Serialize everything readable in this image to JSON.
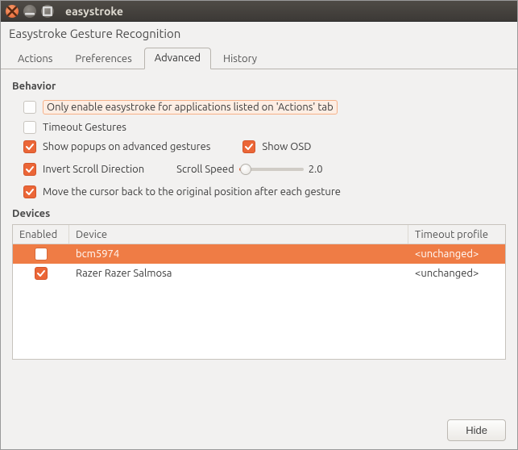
{
  "window": {
    "title": "easystroke",
    "subtitle": "Easystroke Gesture Recognition"
  },
  "tabs": {
    "items": [
      "Actions",
      "Preferences",
      "Advanced",
      "History"
    ],
    "active": 2
  },
  "behavior": {
    "title": "Behavior",
    "only_enable": {
      "label": "Only enable easystroke for applications listed on 'Actions' tab",
      "checked": false,
      "highlight": true
    },
    "timeout_gestures": {
      "label": "Timeout Gestures",
      "checked": false
    },
    "show_popups": {
      "label": "Show popups on advanced gestures",
      "checked": true
    },
    "show_osd": {
      "label": "Show OSD",
      "checked": true
    },
    "invert_scroll": {
      "label": "Invert Scroll Direction",
      "checked": true
    },
    "scroll_speed": {
      "label": "Scroll Speed",
      "value": "2.0"
    },
    "move_cursor_back": {
      "label": "Move the cursor back to the original position after each gesture",
      "checked": true
    }
  },
  "devices": {
    "title": "Devices",
    "columns": [
      "Enabled",
      "Device",
      "Timeout profile"
    ],
    "rows": [
      {
        "enabled": false,
        "device": "bcm5974",
        "timeout": "<unchanged>",
        "selected": true
      },
      {
        "enabled": true,
        "device": "Razer Razer Salmosa",
        "timeout": "<unchanged>",
        "selected": false
      }
    ]
  },
  "footer": {
    "hide": "Hide"
  }
}
